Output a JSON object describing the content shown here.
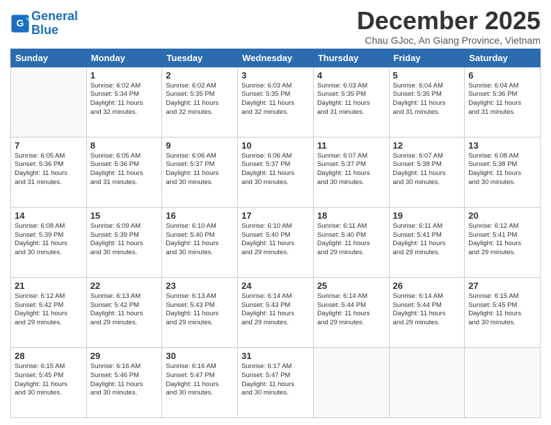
{
  "logo": {
    "line1": "General",
    "line2": "Blue"
  },
  "title": "December 2025",
  "subtitle": "Chau GJoc, An Giang Province, Vietnam",
  "headers": [
    "Sunday",
    "Monday",
    "Tuesday",
    "Wednesday",
    "Thursday",
    "Friday",
    "Saturday"
  ],
  "weeks": [
    [
      {
        "num": "",
        "detail": ""
      },
      {
        "num": "1",
        "detail": "Sunrise: 6:02 AM\nSunset: 5:34 PM\nDaylight: 11 hours\nand 32 minutes."
      },
      {
        "num": "2",
        "detail": "Sunrise: 6:02 AM\nSunset: 5:35 PM\nDaylight: 11 hours\nand 32 minutes."
      },
      {
        "num": "3",
        "detail": "Sunrise: 6:03 AM\nSunset: 5:35 PM\nDaylight: 11 hours\nand 32 minutes."
      },
      {
        "num": "4",
        "detail": "Sunrise: 6:03 AM\nSunset: 5:35 PM\nDaylight: 11 hours\nand 31 minutes."
      },
      {
        "num": "5",
        "detail": "Sunrise: 6:04 AM\nSunset: 5:35 PM\nDaylight: 11 hours\nand 31 minutes."
      },
      {
        "num": "6",
        "detail": "Sunrise: 6:04 AM\nSunset: 5:36 PM\nDaylight: 11 hours\nand 31 minutes."
      }
    ],
    [
      {
        "num": "7",
        "detail": "Sunrise: 6:05 AM\nSunset: 5:36 PM\nDaylight: 11 hours\nand 31 minutes."
      },
      {
        "num": "8",
        "detail": "Sunrise: 6:05 AM\nSunset: 5:36 PM\nDaylight: 11 hours\nand 31 minutes."
      },
      {
        "num": "9",
        "detail": "Sunrise: 6:06 AM\nSunset: 5:37 PM\nDaylight: 11 hours\nand 30 minutes."
      },
      {
        "num": "10",
        "detail": "Sunrise: 6:06 AM\nSunset: 5:37 PM\nDaylight: 11 hours\nand 30 minutes."
      },
      {
        "num": "11",
        "detail": "Sunrise: 6:07 AM\nSunset: 5:37 PM\nDaylight: 11 hours\nand 30 minutes."
      },
      {
        "num": "12",
        "detail": "Sunrise: 6:07 AM\nSunset: 5:38 PM\nDaylight: 11 hours\nand 30 minutes."
      },
      {
        "num": "13",
        "detail": "Sunrise: 6:08 AM\nSunset: 5:38 PM\nDaylight: 11 hours\nand 30 minutes."
      }
    ],
    [
      {
        "num": "14",
        "detail": "Sunrise: 6:08 AM\nSunset: 5:39 PM\nDaylight: 11 hours\nand 30 minutes."
      },
      {
        "num": "15",
        "detail": "Sunrise: 6:09 AM\nSunset: 5:39 PM\nDaylight: 11 hours\nand 30 minutes."
      },
      {
        "num": "16",
        "detail": "Sunrise: 6:10 AM\nSunset: 5:40 PM\nDaylight: 11 hours\nand 30 minutes."
      },
      {
        "num": "17",
        "detail": "Sunrise: 6:10 AM\nSunset: 5:40 PM\nDaylight: 11 hours\nand 29 minutes."
      },
      {
        "num": "18",
        "detail": "Sunrise: 6:11 AM\nSunset: 5:40 PM\nDaylight: 11 hours\nand 29 minutes."
      },
      {
        "num": "19",
        "detail": "Sunrise: 6:11 AM\nSunset: 5:41 PM\nDaylight: 11 hours\nand 29 minutes."
      },
      {
        "num": "20",
        "detail": "Sunrise: 6:12 AM\nSunset: 5:41 PM\nDaylight: 11 hours\nand 29 minutes."
      }
    ],
    [
      {
        "num": "21",
        "detail": "Sunrise: 6:12 AM\nSunset: 5:42 PM\nDaylight: 11 hours\nand 29 minutes."
      },
      {
        "num": "22",
        "detail": "Sunrise: 6:13 AM\nSunset: 5:42 PM\nDaylight: 11 hours\nand 29 minutes."
      },
      {
        "num": "23",
        "detail": "Sunrise: 6:13 AM\nSunset: 5:43 PM\nDaylight: 11 hours\nand 29 minutes."
      },
      {
        "num": "24",
        "detail": "Sunrise: 6:14 AM\nSunset: 5:43 PM\nDaylight: 11 hours\nand 29 minutes."
      },
      {
        "num": "25",
        "detail": "Sunrise: 6:14 AM\nSunset: 5:44 PM\nDaylight: 11 hours\nand 29 minutes."
      },
      {
        "num": "26",
        "detail": "Sunrise: 6:14 AM\nSunset: 5:44 PM\nDaylight: 11 hours\nand 29 minutes."
      },
      {
        "num": "27",
        "detail": "Sunrise: 6:15 AM\nSunset: 5:45 PM\nDaylight: 11 hours\nand 30 minutes."
      }
    ],
    [
      {
        "num": "28",
        "detail": "Sunrise: 6:15 AM\nSunset: 5:45 PM\nDaylight: 11 hours\nand 30 minutes."
      },
      {
        "num": "29",
        "detail": "Sunrise: 6:16 AM\nSunset: 5:46 PM\nDaylight: 11 hours\nand 30 minutes."
      },
      {
        "num": "30",
        "detail": "Sunrise: 6:16 AM\nSunset: 5:47 PM\nDaylight: 11 hours\nand 30 minutes."
      },
      {
        "num": "31",
        "detail": "Sunrise: 6:17 AM\nSunset: 5:47 PM\nDaylight: 11 hours\nand 30 minutes."
      },
      {
        "num": "",
        "detail": ""
      },
      {
        "num": "",
        "detail": ""
      },
      {
        "num": "",
        "detail": ""
      }
    ]
  ]
}
